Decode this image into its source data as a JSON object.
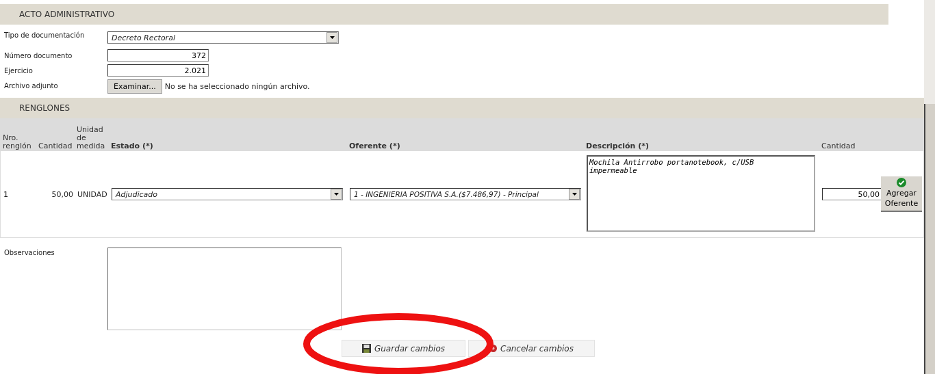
{
  "acto": {
    "title": "ACTO ADMINISTRATIVO",
    "fields": [
      {
        "kind": "select",
        "label": "Tipo de documentación",
        "value": "Decreto Rectoral"
      },
      {
        "kind": "number",
        "label": "Número documento",
        "value": "372"
      },
      {
        "kind": "number",
        "label": "Ejercicio",
        "value": "2.021"
      },
      {
        "kind": "file",
        "label": "Archivo adjunto",
        "button": "Examinar...",
        "value": "No se ha seleccionado ningún archivo."
      }
    ]
  },
  "renglones": {
    "title": "RENGLONES",
    "columns": [
      {
        "label": "Nro. renglón",
        "required": false
      },
      {
        "label": "Cantidad",
        "required": false
      },
      {
        "label": "Unidad de medida",
        "required": false
      },
      {
        "label": "Estado (*)",
        "required": true
      },
      {
        "label": "Oferente (*)",
        "required": true
      },
      {
        "label": "Descripción (*)",
        "required": true
      },
      {
        "label": "Cantidad",
        "required": false
      }
    ],
    "rows": [
      {
        "nro": "1",
        "cantidad": "50,00",
        "unidad": "UNIDAD",
        "estado": "Adjudicado",
        "oferente": "1 - INGENIERIA POSITIVA S.A.($7.486,97) - Principal",
        "descripcion": "Mochila Antirrobo portanotebook, c/USB\nimpermeable",
        "cantidad_input": "50,00",
        "action": "Agregar Oferente"
      }
    ]
  },
  "observaciones": {
    "label": "Observaciones"
  },
  "buttons": [
    {
      "kind": "save",
      "label": "Guardar cambios"
    },
    {
      "kind": "cancel",
      "label": "Cancelar cambios"
    }
  ],
  "annotation": {
    "kind": "ellipse"
  }
}
